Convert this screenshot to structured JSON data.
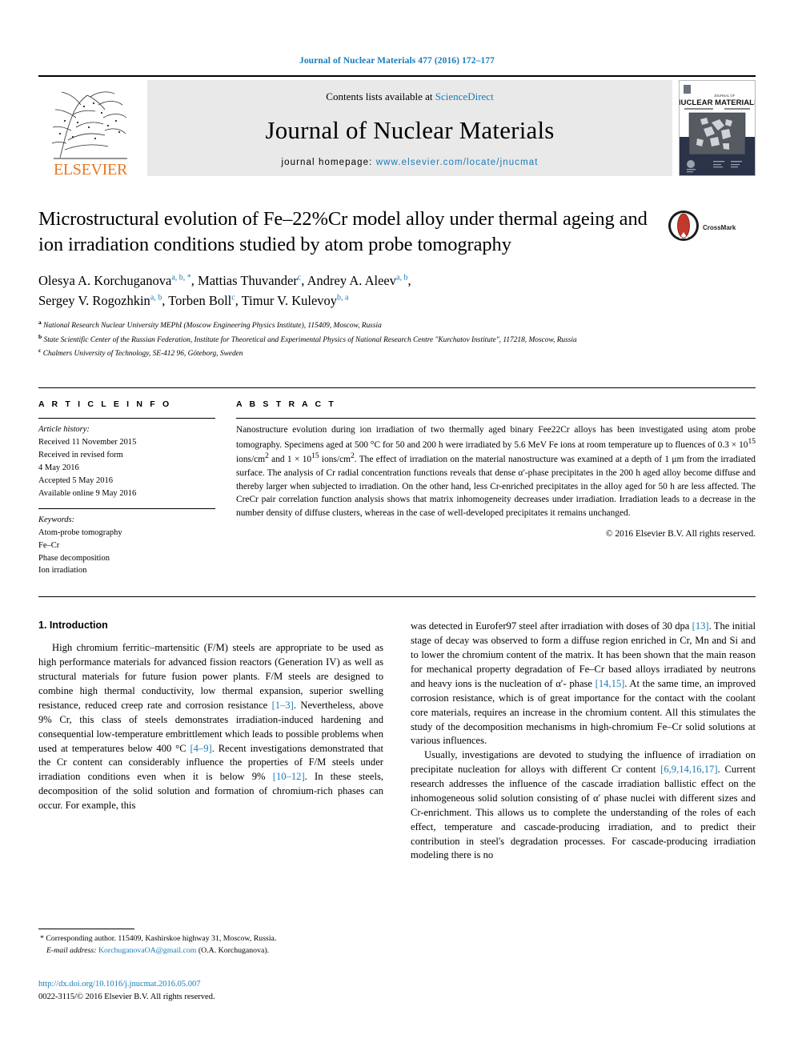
{
  "running_head": "Journal of Nuclear Materials 477 (2016) 172–177",
  "masthead": {
    "publisher": "ELSEVIER",
    "contents_prefix": "Contents lists available at ",
    "contents_link": "ScienceDirect",
    "journal_title": "Journal of Nuclear Materials",
    "homepage_prefix": "journal homepage: ",
    "homepage_url": "www.elsevier.com/locate/jnucmat",
    "cover_line1": "JOURNAL OF",
    "cover_line2": "NUCLEAR MATERIALS"
  },
  "article": {
    "title": "Microstructural evolution of Fe–22%Cr model alloy under thermal ageing and ion irradiation conditions studied by atom probe tomography",
    "crossmark_label": "CrossMark",
    "authors_line1": "Olesya A. Korchuganova",
    "authors_line1_sup": "a, b, *",
    "authors_2": "Mattias Thuvander",
    "authors_2_sup": "c",
    "authors_3": "Andrey A. Aleev",
    "authors_3_sup": "a, b",
    "authors_4": "Sergey V. Rogozhkin",
    "authors_4_sup": "a, b",
    "authors_5": "Torben Boll",
    "authors_5_sup": "c",
    "authors_6": "Timur V. Kulevoy",
    "authors_6_sup": "b, a",
    "affiliation_a_sup": "a",
    "affiliation_a": "National Research Nuclear University MEPhI (Moscow Engineering Physics Institute), 115409, Moscow, Russia",
    "affiliation_b_sup": "b",
    "affiliation_b": "State Scientific Center of the Russian Federation, Institute for Theoretical and Experimental Physics of National Research Centre \"Kurchatov Institute\", 117218, Moscow, Russia",
    "affiliation_c_sup": "c",
    "affiliation_c": "Chalmers University of Technology, SE-412 96, Göteborg, Sweden"
  },
  "article_info": {
    "heading": "A R T I C L E  I N F O",
    "history_label": "Article history:",
    "history": [
      "Received 11 November 2015",
      "Received in revised form",
      "4 May 2016",
      "Accepted 5 May 2016",
      "Available online 9 May 2016"
    ],
    "keywords_label": "Keywords:",
    "keywords": [
      "Atom-probe tomography",
      "Fe–Cr",
      "Phase decomposition",
      "Ion irradiation"
    ]
  },
  "abstract": {
    "heading": "A B S T R A C T",
    "text_part1": "Nanostructure evolution during ion irradiation of two thermally aged binary Fee22Cr alloys has been investigated using atom probe tomography. Specimens aged at 500 °C for 50 and 200 h were irradiated by 5.6 MeV Fe ions at room temperature up to fluences of 0.3 × 10",
    "sup1": "15",
    "text_part2": " ions/cm",
    "sup2": "2",
    "text_part3": " and 1 × 10",
    "sup3": "15",
    "text_part4": " ions/cm",
    "sup4": "2",
    "text_part5": ". The effect of irradiation on the material nanostructure was examined at a depth of 1 μm from the irradiated surface. The analysis of Cr radial concentration functions reveals that dense α′-phase precipitates in the 200 h aged alloy become diffuse and thereby larger when subjected to irradiation. On the other hand, less Cr-enriched precipitates in the alloy aged for 50 h are less affected. The CreCr pair correlation function analysis shows that matrix inhomogeneity decreases under irradiation. Irradiation leads to a decrease in the number density of diffuse clusters, whereas in the case of well-developed precipitates it remains unchanged.",
    "copyright": "© 2016 Elsevier B.V. All rights reserved."
  },
  "body": {
    "section_heading": "1. Introduction",
    "left_p1_a": "High chromium ferritic–martensitic (F/M) steels are appropriate to be used as high performance materials for advanced fission reactors (Generation IV) as well as structural materials for future fusion power plants. F/M steels are designed to combine high thermal conductivity, low thermal expansion, superior swelling resistance, reduced creep rate and corrosion resistance ",
    "left_ref1": "[1–3]",
    "left_p1_b": ". Nevertheless, above 9% Cr, this class of steels demonstrates irradiation-induced hardening and consequential low-temperature embrittlement which leads to possible problems when used at temperatures below 400 °C ",
    "left_ref2": "[4–9]",
    "left_p1_c": ". Recent investigations demonstrated that the Cr content can considerably influence the properties of F/M steels under irradiation conditions even when it is below 9% ",
    "left_ref3": "[10–12]",
    "left_p1_d": ". In these steels, decomposition of the solid solution and formation of chromium-rich phases can occur. For example, this",
    "right_p1_a": "was detected in Eurofer97 steel after irradiation with doses of 30 dpa ",
    "right_ref1": "[13]",
    "right_p1_b": ". The initial stage of decay was observed to form a diffuse region enriched in Cr, Mn and Si and to lower the chromium content of the matrix. It has been shown that the main reason for mechanical property degradation of Fe–Cr based alloys irradiated by neutrons and heavy ions is the nucleation of α′- phase ",
    "right_ref2": "[14,15]",
    "right_p1_c": ". At the same time, an improved corrosion resistance, which is of great importance for the contact with the coolant core materials, requires an increase in the chromium content. All this stimulates the study of the decomposition mechanisms in high-chromium Fe–Cr solid solutions at various influences.",
    "right_p2_a": "Usually, investigations are devoted to studying the influence of irradiation on precipitate nucleation for alloys with different Cr content ",
    "right_ref3": "[6,9,14,16,17]",
    "right_p2_b": ". Current research addresses the influence of the cascade irradiation ballistic effect on the inhomogeneous solid solution consisting of α′ phase nuclei with different sizes and Cr-enrichment. This allows us to complete the understanding of the roles of each effect, temperature and cascade-producing irradiation, and to predict their contribution in steel's degradation processes. For cascade-producing irradiation modeling there is no"
  },
  "footnote": {
    "marker": "*",
    "text": "Corresponding author. 115409, Kashirskoe highway 31, Moscow, Russia.",
    "email_label": "E-mail address:",
    "email": "KorchuganovaOA@gmail.com",
    "email_suffix": " (O.A. Korchuganova)."
  },
  "footer": {
    "doi": "http://dx.doi.org/10.1016/j.jnucmat.2016.05.007",
    "issn_line": "0022-3115/© 2016 Elsevier B.V. All rights reserved."
  },
  "colors": {
    "link_blue": "#1a7bb9",
    "elsevier_orange": "#e87722",
    "crossmark_red": "#c0392b"
  }
}
